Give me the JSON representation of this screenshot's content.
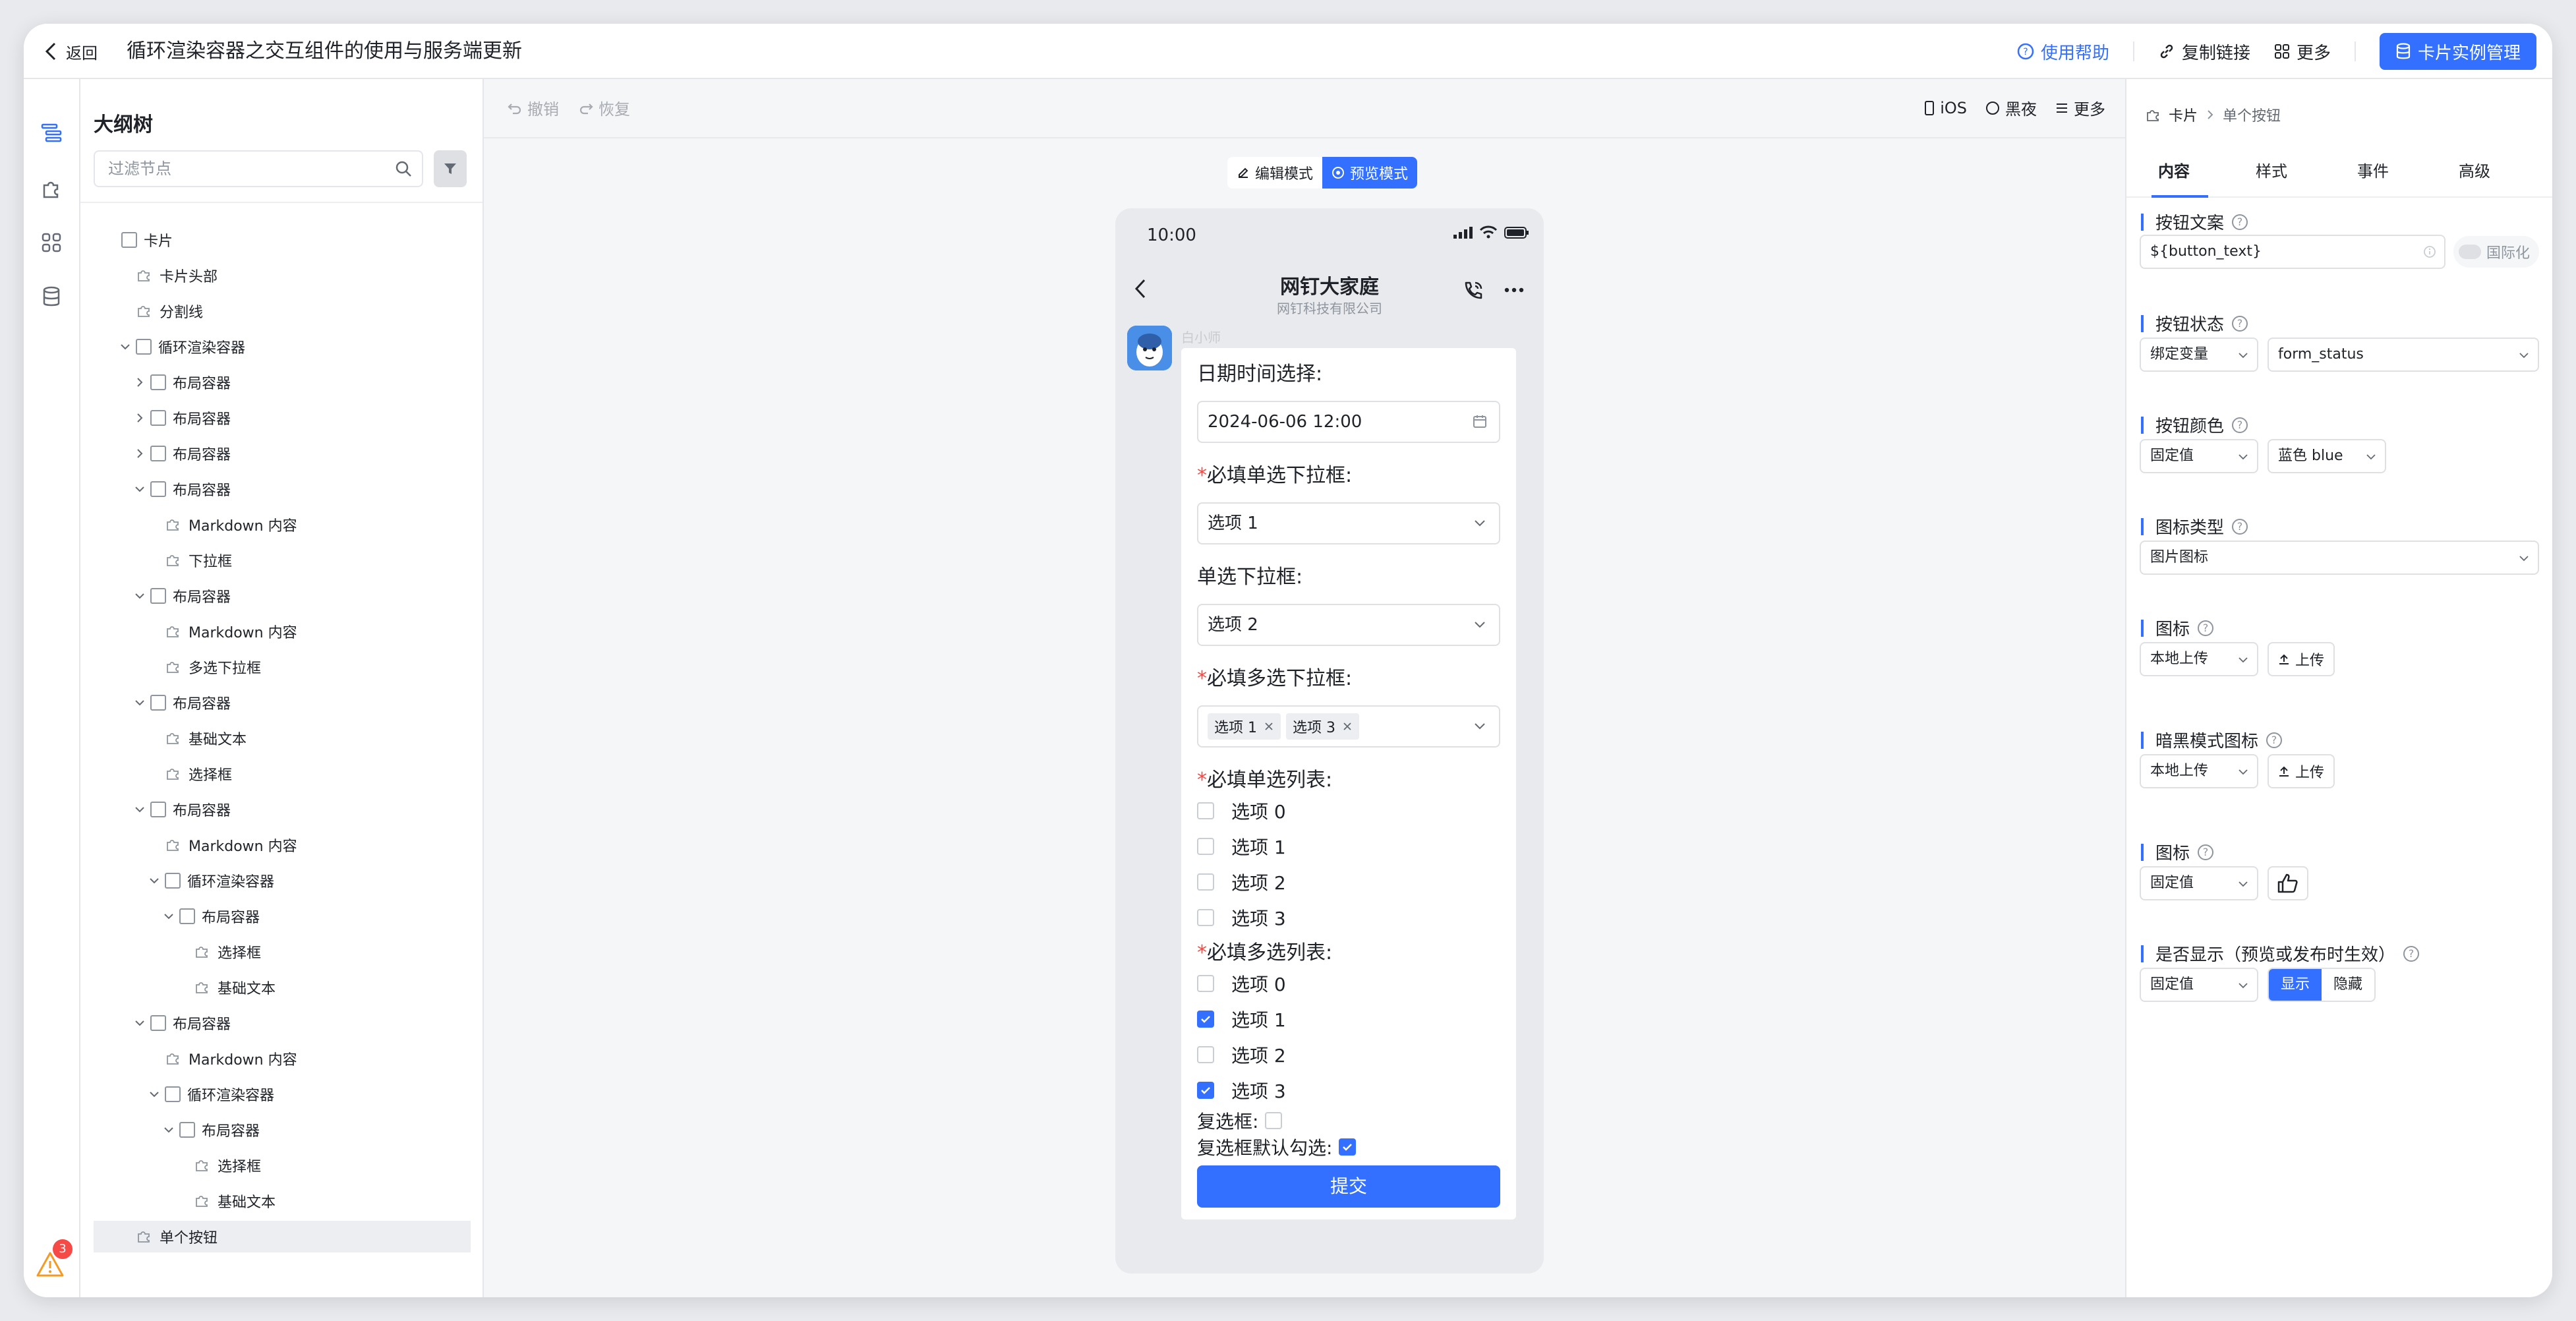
{
  "header": {
    "back_label": "返回",
    "title": "循环渲染容器之交互组件的使用与服务端更新",
    "help": "使用帮助",
    "copy_link": "复制链接",
    "more": "更多",
    "manage": "卡片实例管理"
  },
  "rail": {
    "warning_count": "3"
  },
  "outline": {
    "title": "大纲树",
    "filter_placeholder": "过滤节点",
    "nodes": [
      "卡片",
      "卡片头部",
      "分割线",
      "循环渲染容器",
      "布局容器",
      "布局容器",
      "布局容器",
      "布局容器",
      "Markdown 内容",
      "下拉框",
      "布局容器",
      "Markdown 内容",
      "多选下拉框",
      "布局容器",
      "基础文本",
      "选择框",
      "布局容器",
      "Markdown 内容",
      "循环渲染容器",
      "布局容器",
      "选择框",
      "基础文本",
      "布局容器",
      "Markdown 内容",
      "循环渲染容器",
      "布局容器",
      "选择框",
      "基础文本",
      "单个按钮"
    ]
  },
  "toolbar": {
    "undo": "撤销",
    "redo": "恢复",
    "ios": "iOS",
    "dark": "黑夜",
    "more": "更多",
    "edit_mode": "编辑模式",
    "preview_mode": "预览模式"
  },
  "phone": {
    "time": "10:00",
    "chat_title": "网钉大家庭",
    "chat_sub": "网钉科技有限公司",
    "bot_name": "白小师",
    "form": {
      "date_label": "日期时间选择:",
      "date_value": "2024-06-06 12:00",
      "req_single_label": "必填单选下拉框:",
      "req_single_value": "选项 1",
      "single_label": "单选下拉框:",
      "single_value": "选项 2",
      "req_multi_label": "必填多选下拉框:",
      "tags": [
        "选项 1",
        "选项 3"
      ],
      "req_radio_label": "必填单选列表:",
      "radio_opts": [
        "选项 0",
        "选项 1",
        "选项 2",
        "选项 3"
      ],
      "req_check_label": "必填多选列表:",
      "check_opts": [
        "选项 0",
        "选项 1",
        "选项 2",
        "选项 3"
      ],
      "checkbox_label": "复选框:",
      "checkbox_default_label": "复选框默认勾选:",
      "submit": "提交"
    }
  },
  "props": {
    "crumb_card": "卡片",
    "crumb_node": "单个按钮",
    "tabs": [
      "内容",
      "样式",
      "事件",
      "高级"
    ],
    "btn_text_label": "按钮文案",
    "btn_text_value": "${button_text}",
    "intl": "国际化",
    "btn_state_label": "按钮状态",
    "bind_var": "绑定变量",
    "form_status": "form_status",
    "btn_color_label": "按钮颜色",
    "fixed": "固定值",
    "blue": "蓝色 blue",
    "icon_type_label": "图标类型",
    "icon_type_value": "图片图标",
    "icon_label": "图标",
    "local_upload": "本地上传",
    "upload": "上传",
    "dark_icon_label": "暗黑模式图标",
    "icon_label2": "图标",
    "visible_label": "是否显示（预览或发布时生效）",
    "show": "显示",
    "hide": "隐藏"
  },
  "colors": {
    "accent": "#3370ff",
    "required": "#f54a45"
  }
}
